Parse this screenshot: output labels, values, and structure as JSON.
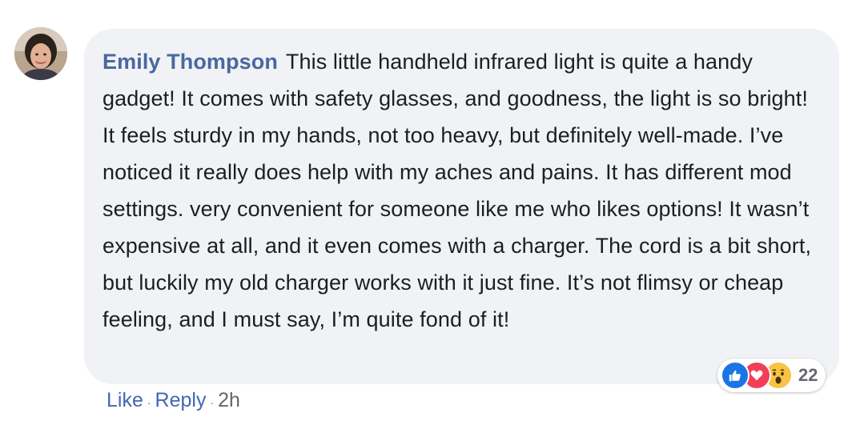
{
  "comment": {
    "author": "Emily Thompson",
    "text": "This little handheld infrared light is quite a handy gadget! It comes with safety glasses, and goodness, the light is so bright! It feels sturdy in my hands, not too heavy, but definitely well-made. I’ve noticed it really does help with my aches and pains. It has different mod settings. very convenient for someone like me who likes options! It wasn’t expensive at all, and it even comes with a charger. The cord is a bit short, but luckily my old charger works with it just fine. It’s not flimsy or cheap feeling, and I must say, I’m quite fond of it!"
  },
  "reactions": {
    "icons": [
      "like-icon",
      "love-icon",
      "wow-icon"
    ],
    "count": "22",
    "colors": {
      "like": "#1b74e4",
      "love": "#f33e58",
      "wow": "#f7c443"
    }
  },
  "actions": {
    "like_label": "Like",
    "separator": "·",
    "reply_label": "Reply",
    "time": "2h"
  },
  "colors": {
    "bubble": "#f0f2f5",
    "author": "#4b67a1",
    "link": "#4267b2",
    "meta": "#65676b"
  }
}
